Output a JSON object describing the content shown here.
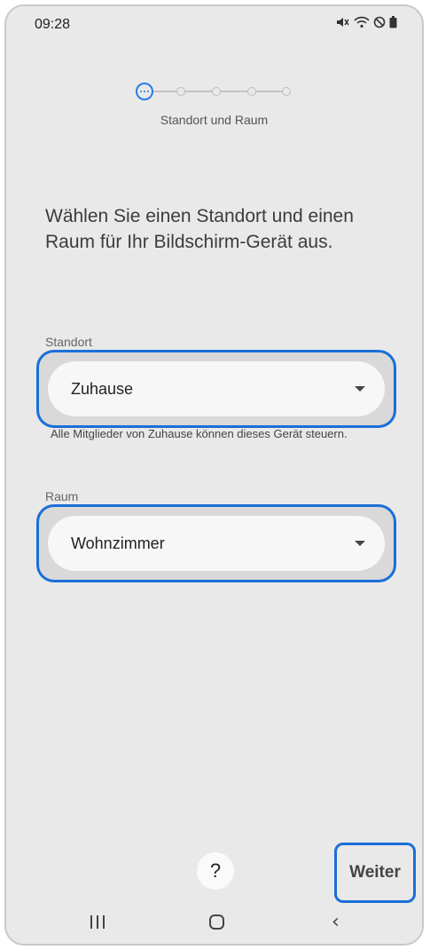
{
  "status_bar": {
    "time": "09:28",
    "icons": [
      "mute-icon",
      "wifi-icon",
      "do-not-disturb-icon",
      "battery-icon"
    ]
  },
  "stepper": {
    "current_step": 1,
    "total_steps": 5,
    "label": "Standort und Raum"
  },
  "heading": "Wählen Sie einen Standort und einen Raum für Ihr Bildschirm-Gerät aus.",
  "location": {
    "label": "Standort",
    "value": "Zuhause",
    "helper": "Alle Mitglieder von Zuhause können dieses Gerät steuern."
  },
  "room": {
    "label": "Raum",
    "value": "Wohnzimmer"
  },
  "footer": {
    "help_label": "?",
    "next_label": "Weiter"
  },
  "colors": {
    "accent": "#2b7be4",
    "highlight": "#1a6fd8",
    "background": "#e9e9e9"
  }
}
